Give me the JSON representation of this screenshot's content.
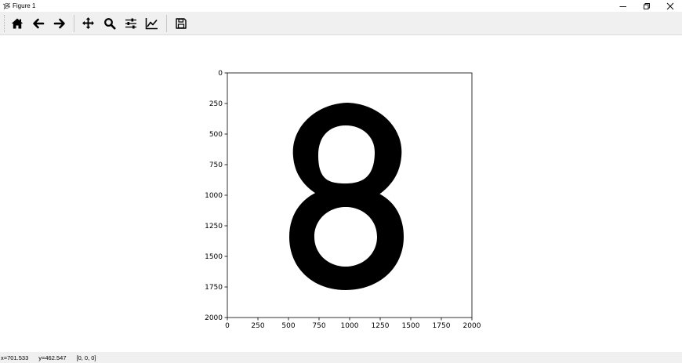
{
  "window": {
    "title": "Figure 1",
    "app_icon": "matplotlib-figure-icon",
    "controls": [
      "minimize-icon",
      "restore-icon",
      "close-icon"
    ]
  },
  "toolbar": {
    "buttons": [
      {
        "id": "home",
        "icon": "home-icon",
        "label": "Home"
      },
      {
        "id": "back",
        "icon": "arrow-left-icon",
        "label": "Back"
      },
      {
        "id": "forward",
        "icon": "arrow-right-icon",
        "label": "Forward"
      },
      {
        "id": "pan",
        "icon": "move-icon",
        "label": "Pan"
      },
      {
        "id": "zoom",
        "icon": "magnifier-icon",
        "label": "Zoom"
      },
      {
        "id": "subplots",
        "icon": "sliders-icon",
        "label": "Subplots"
      },
      {
        "id": "axes",
        "icon": "line-chart-icon",
        "label": "Customize"
      },
      {
        "id": "save",
        "icon": "floppy-disk-icon",
        "label": "Save"
      }
    ]
  },
  "plot": {
    "x_ticks": [
      "0",
      "250",
      "500",
      "750",
      "1000",
      "1250",
      "1500",
      "1750",
      "2000"
    ],
    "y_ticks": [
      "0",
      "250",
      "500",
      "750",
      "1000",
      "1250",
      "1500",
      "1750",
      "2000"
    ],
    "image_content": "8",
    "xlim": [
      0,
      2000
    ],
    "ylim": [
      2000,
      0
    ],
    "y_axis_inverted": true,
    "grid": false,
    "colors": {
      "glyph": "#000000",
      "background": "#ffffff",
      "frame": "#000000"
    }
  },
  "status": {
    "x": "x=701.533",
    "y": "y=462.547",
    "pixel": "[0, 0, 0]"
  }
}
